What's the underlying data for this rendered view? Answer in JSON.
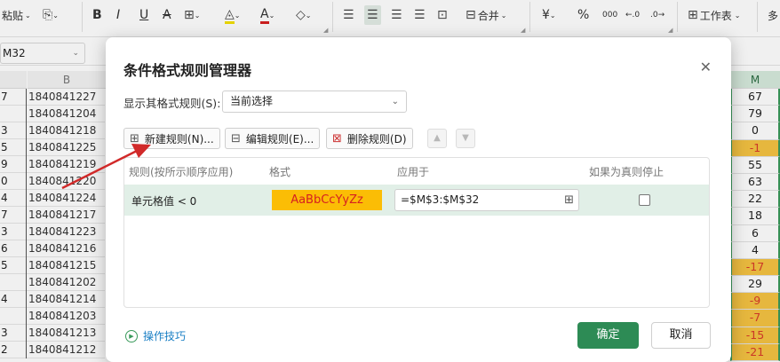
{
  "ribbon": {
    "paste": "粘贴",
    "bold": "B",
    "italic": "I",
    "underline": "U",
    "strike": "A",
    "font_color": "A",
    "merge": "合并",
    "currency": "¥",
    "percent": "%",
    "thousands": "000",
    "inc_decimal": "←.0",
    "dec_decimal": ".0→",
    "worksheet": "工作表",
    "more": "多"
  },
  "formula_bar": {
    "name_box": "M32"
  },
  "columns": {
    "a": "",
    "b": "B",
    "m": "M"
  },
  "grid_left": {
    "rows": [
      {
        "a": "7",
        "b": "1840841227"
      },
      {
        "a": "",
        "b": "1840841204"
      },
      {
        "a": "3",
        "b": "1840841218"
      },
      {
        "a": "5",
        "b": "1840841225"
      },
      {
        "a": "9",
        "b": "1840841219"
      },
      {
        "a": "0",
        "b": "1840841220"
      },
      {
        "a": "4",
        "b": "1840841224"
      },
      {
        "a": "7",
        "b": "1840841217"
      },
      {
        "a": "3",
        "b": "1840841223"
      },
      {
        "a": "6",
        "b": "1840841216"
      },
      {
        "a": "5",
        "b": "1840841215"
      },
      {
        "a": "",
        "b": "1840841202"
      },
      {
        "a": "4",
        "b": "1840841214"
      },
      {
        "a": "",
        "b": "1840841203"
      },
      {
        "a": "3",
        "b": "1840841213"
      },
      {
        "a": "2",
        "b": "1840841212"
      }
    ]
  },
  "grid_right": {
    "values": [
      "67",
      "79",
      "0",
      "-1",
      "55",
      "63",
      "22",
      "18",
      "6",
      "4",
      "-17",
      "29",
      "-9",
      "-7",
      "-15",
      "-21"
    ]
  },
  "dialog": {
    "title": "条件格式规则管理器",
    "show_rules_label": "显示其格式规则(S):",
    "show_rules_value": "当前选择",
    "new_rule": "新建规则(N)...",
    "edit_rule": "编辑规则(E)...",
    "delete_rule": "删除规则(D)",
    "columns": {
      "rule": "规则(按所示顺序应用)",
      "format": "格式",
      "applies_to": "应用于",
      "stop_if_true": "如果为真则停止"
    },
    "rule_row": {
      "rule": "单元格值 < 0",
      "preview": "AaBbCcYyZz",
      "applies_to": "=$M$3:$M$32",
      "stop_if_true": false
    },
    "tips": "操作技巧",
    "ok": "确定",
    "cancel": "取消"
  },
  "colors": {
    "accent": "#2d8b55",
    "highlight": "#f5c342",
    "negative_text": "#d83b2a",
    "annotation_arrow": "#d12a2a"
  }
}
